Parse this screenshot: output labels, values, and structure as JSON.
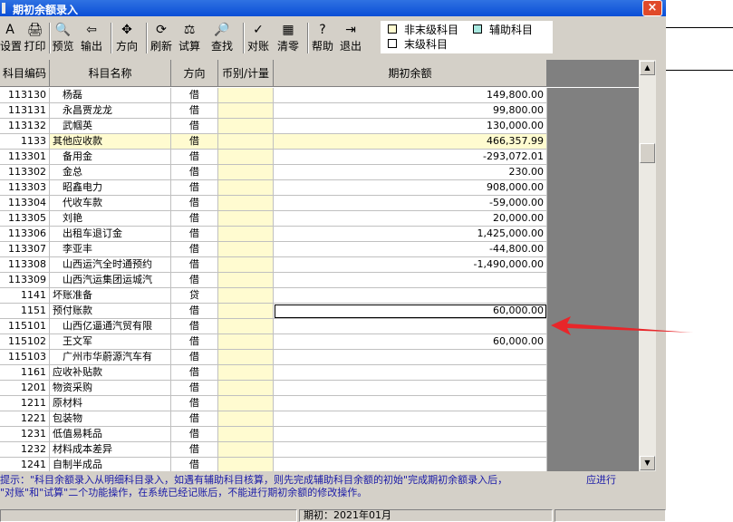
{
  "window": {
    "title": "期初余额录入",
    "close_glyph": "×"
  },
  "toolbar": [
    {
      "label": "设置",
      "icon": "A"
    },
    {
      "label": "打印",
      "icon": "🖨"
    },
    {
      "label": "预览",
      "icon": "🔍"
    },
    {
      "label": "输出",
      "icon": "⇦"
    },
    {
      "label": "方向",
      "icon": "✥"
    },
    {
      "label": "刷新",
      "icon": "⟳"
    },
    {
      "label": "试算",
      "icon": "⚖"
    },
    {
      "label": "查找",
      "icon": "🔎"
    },
    {
      "label": "对账",
      "icon": "✓"
    },
    {
      "label": "清零",
      "icon": "▦"
    },
    {
      "label": "帮助",
      "icon": "?"
    },
    {
      "label": "退出",
      "icon": "⇥"
    }
  ],
  "legend": {
    "non_leaf": {
      "label": "非末级科目",
      "color": "#fffbd0"
    },
    "auxiliary": {
      "label": "辅助科目",
      "color": "#a8e8e0"
    },
    "leaf": {
      "label": "末级科目",
      "color": "#ffffff"
    }
  },
  "table": {
    "columns": [
      "科目编码",
      "科目名称",
      "方向",
      "币别/计量",
      "期初余额"
    ],
    "rows": [
      {
        "code": "113130",
        "name": "杨磊",
        "dir": "借",
        "amount": "149,800.00",
        "level": 2
      },
      {
        "code": "113131",
        "name": "永昌贾龙龙",
        "dir": "借",
        "amount": "99,800.00",
        "level": 2
      },
      {
        "code": "113132",
        "name": "武帼英",
        "dir": "借",
        "amount": "130,000.00",
        "level": 2
      },
      {
        "code": "1133",
        "name": "其他应收款",
        "dir": "借",
        "amount": "466,357.99",
        "level": 1,
        "agg": true
      },
      {
        "code": "113301",
        "name": "备用金",
        "dir": "借",
        "amount": "-293,072.01",
        "level": 2
      },
      {
        "code": "113302",
        "name": "金总",
        "dir": "借",
        "amount": "230.00",
        "level": 2
      },
      {
        "code": "113303",
        "name": "昭鑫电力",
        "dir": "借",
        "amount": "908,000.00",
        "level": 2
      },
      {
        "code": "113304",
        "name": "代收车款",
        "dir": "借",
        "amount": "-59,000.00",
        "level": 2
      },
      {
        "code": "113305",
        "name": "刘艳",
        "dir": "借",
        "amount": "20,000.00",
        "level": 2
      },
      {
        "code": "113306",
        "name": "出租车退订金",
        "dir": "借",
        "amount": "1,425,000.00",
        "level": 2
      },
      {
        "code": "113307",
        "name": "李亚丰",
        "dir": "借",
        "amount": "-44,800.00",
        "level": 2
      },
      {
        "code": "113308",
        "name": "山西运汽全时通预约",
        "dir": "借",
        "amount": "-1,490,000.00",
        "level": 2
      },
      {
        "code": "113309",
        "name": "山西汽运集团运城汽",
        "dir": "借",
        "amount": "",
        "level": 2
      },
      {
        "code": "1141",
        "name": "坏账准备",
        "dir": "贷",
        "amount": "",
        "level": 1
      },
      {
        "code": "1151",
        "name": "预付账款",
        "dir": "借",
        "amount": "60,000.00",
        "level": 1,
        "selected": true
      },
      {
        "code": "115101",
        "name": "山西亿逼通汽贸有限",
        "dir": "借",
        "amount": "",
        "level": 2
      },
      {
        "code": "115102",
        "name": "王文军",
        "dir": "借",
        "amount": "60,000.00",
        "level": 2
      },
      {
        "code": "115103",
        "name": "广州市华蔚源汽车有",
        "dir": "借",
        "amount": "",
        "level": 2
      },
      {
        "code": "1161",
        "name": "应收补贴款",
        "dir": "借",
        "amount": "",
        "level": 1
      },
      {
        "code": "1201",
        "name": "物资采购",
        "dir": "借",
        "amount": "",
        "level": 1
      },
      {
        "code": "1211",
        "name": "原材料",
        "dir": "借",
        "amount": "",
        "level": 1
      },
      {
        "code": "1221",
        "name": "包装物",
        "dir": "借",
        "amount": "",
        "level": 1
      },
      {
        "code": "1231",
        "name": "低值易耗品",
        "dir": "借",
        "amount": "",
        "level": 1
      },
      {
        "code": "1232",
        "name": "材料成本差异",
        "dir": "借",
        "amount": "",
        "level": 1
      },
      {
        "code": "1241",
        "name": "自制半成品",
        "dir": "借",
        "amount": "",
        "level": 1
      }
    ]
  },
  "hint": {
    "line1": "提示：\"科目余额录入从明细科目录入，如遇有辅助科目核算，则先完成辅助科目余额的初始\"完成期初余额录入后，",
    "line1_tail": "应进行",
    "line2": "\"对账\"和\"试算\"二个功能操作，在系统已经记账后，不能进行期初余额的修改操作。"
  },
  "status": {
    "period": "期初：2021年01月"
  }
}
